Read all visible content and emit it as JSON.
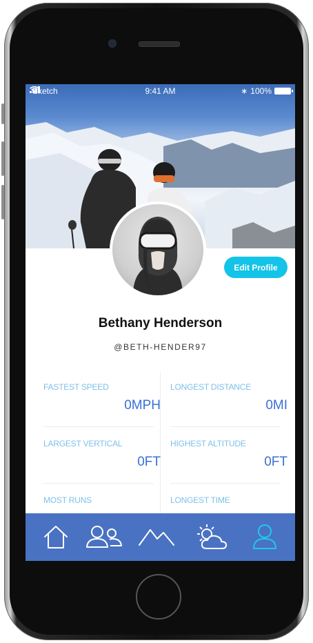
{
  "status_bar": {
    "carrier": "Sketch",
    "time": "9:41 AM",
    "battery": "100%"
  },
  "profile": {
    "name": "Bethany Henderson",
    "handle": "@BETH-HENDER97",
    "edit_label": "Edit Profile"
  },
  "stats": [
    {
      "label": "FASTEST SPEED",
      "value": "0MPH"
    },
    {
      "label": "LONGEST DISTANCE",
      "value": "0MI"
    },
    {
      "label": "LARGEST VERTICAL",
      "value": "0FT"
    },
    {
      "label": "HIGHEST ALTITUDE",
      "value": "0FT"
    },
    {
      "label": "MOST RUNS",
      "value": ""
    },
    {
      "label": "LONGEST TIME",
      "value": ""
    }
  ],
  "tabs": [
    {
      "icon": "home-icon",
      "active": false
    },
    {
      "icon": "friends-icon",
      "active": false
    },
    {
      "icon": "mountains-icon",
      "active": false
    },
    {
      "icon": "weather-icon",
      "active": false
    },
    {
      "icon": "profile-icon",
      "active": true
    }
  ],
  "colors": {
    "accent": "#14c3e8",
    "tabbar": "#4a72c2",
    "stat_label": "#7ec0ea",
    "stat_value": "#3a6fd3",
    "tab_icon": "#ffffff",
    "tab_icon_active": "#1ec8f0"
  }
}
